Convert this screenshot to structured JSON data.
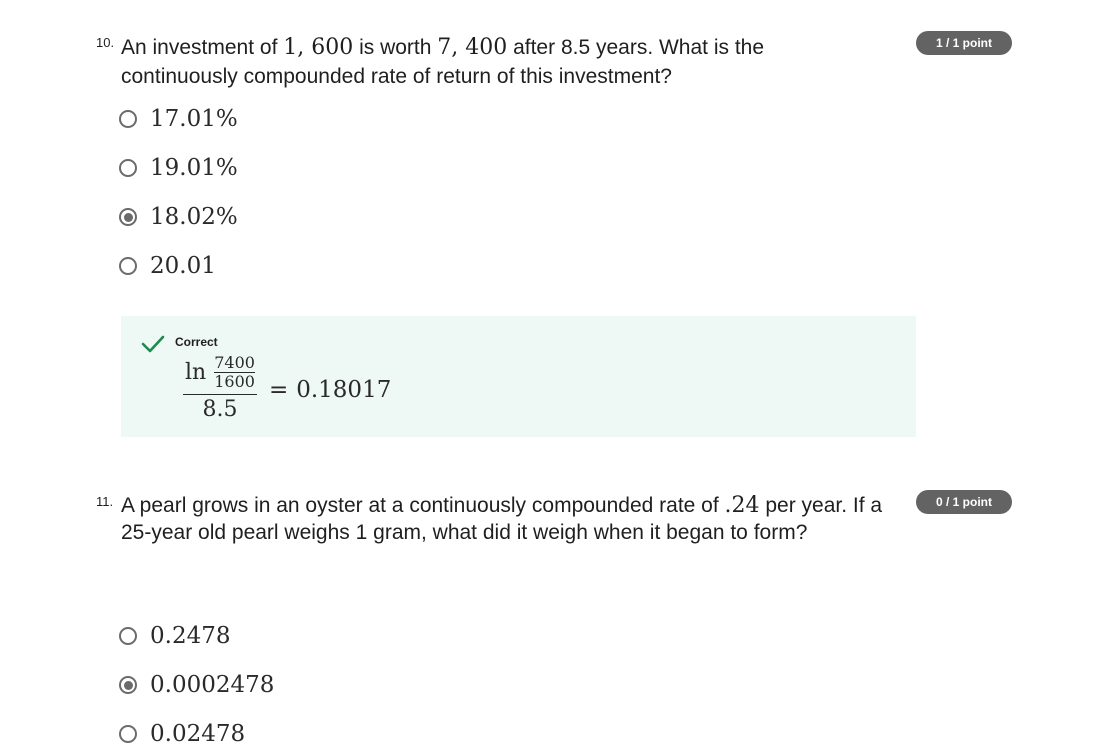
{
  "questions": [
    {
      "number": "10.",
      "text_parts": [
        "An investment of ",
        "1, 600",
        " is worth ",
        "7, 400",
        " after 8.5 years. What is the continuously compounded rate of return of this investment?"
      ],
      "score": "1 / 1 point",
      "options": [
        {
          "label": "17.01%",
          "selected": false
        },
        {
          "label": "19.01%",
          "selected": false
        },
        {
          "label": "18.02%",
          "selected": true
        },
        {
          "label": "20.01",
          "selected": false
        }
      ],
      "feedback": {
        "status": "Correct",
        "formula": {
          "ln": "ln",
          "inner_numerator": "7400",
          "inner_denominator": "1600",
          "denominator": "8.5",
          "equals": "=",
          "result": "0.18017"
        }
      }
    },
    {
      "number": "11.",
      "text_parts": [
        "A pearl grows in an oyster at a continuously compounded rate of ",
        ".24",
        " per year. If a 25-year old pearl weighs 1 gram, what did it weigh when it began to form?"
      ],
      "score": "0 / 1 point",
      "options": [
        {
          "label": "0.2478",
          "selected": false
        },
        {
          "label": "0.0002478",
          "selected": true
        },
        {
          "label": "0.02478",
          "selected": false
        }
      ]
    }
  ],
  "colors": {
    "badge": "#636363",
    "feedback_bg": "#eef8f5",
    "check": "#1d8a4e",
    "radio": "#6b6b6b"
  }
}
